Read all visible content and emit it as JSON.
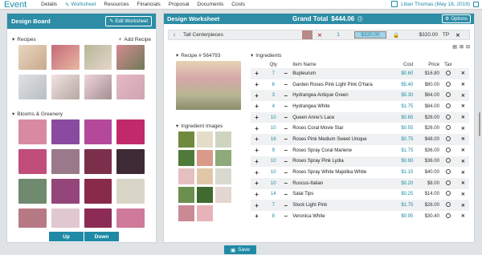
{
  "nav": {
    "brand": "Event",
    "items": [
      "Details",
      "Worksheet",
      "Resources",
      "Financials",
      "Proposal",
      "Documents",
      "Costs"
    ],
    "active_index": 1,
    "user": "Lilian Thomas (May 18, 2019)"
  },
  "left": {
    "title": "Design Board",
    "edit_label": "Edit Worksheet",
    "recipes_label": "Recipes",
    "add_recipe_label": "Add Recipe",
    "blooms_label": "Blooms & Greenery",
    "up_label": "Up",
    "down_label": "Down"
  },
  "right": {
    "title": "Design Worksheet",
    "grand_total_label": "Grand Total",
    "grand_total": "$444.06",
    "options_label": "Options",
    "item": {
      "name": "Tall Centerpieces",
      "qty": "1",
      "unit_price": "$320.00",
      "total": "$320.00",
      "code": "TP"
    },
    "recipe_label": "Recipe # 564793",
    "ingredient_images_label": "Ingredient Images",
    "ingredients_label": "Ingredients",
    "columns": {
      "qty": "Qty",
      "item": "Item Name",
      "cost": "Cost",
      "price": "Price",
      "tax": "Tax"
    },
    "rows": [
      {
        "qty": "7",
        "name": "Bupleurum",
        "cost": "$0.60",
        "price": "$16.80"
      },
      {
        "qty": "6",
        "name": "Garden Roses Pink Light Pink O'hara",
        "cost": "$5.40",
        "price": "$80.00"
      },
      {
        "qty": "3",
        "name": "Hydrangea Antique Green",
        "cost": "$5.30",
        "price": "$64.00"
      },
      {
        "qty": "4",
        "name": "Hydrangea White",
        "cost": "$1.75",
        "price": "$84.00"
      },
      {
        "qty": "10",
        "name": "Queen Anne's Lace",
        "cost": "$0.65",
        "price": "$26.00"
      },
      {
        "qty": "10",
        "name": "Roses Coral Movie Star",
        "cost": "$0.55",
        "price": "$26.00"
      },
      {
        "qty": "16",
        "name": "Roses Pink Medium Sweet Unique",
        "cost": "$0.75",
        "price": "$48.00"
      },
      {
        "qty": "9",
        "name": "Roses Spray Coral Mariene",
        "cost": "$1.75",
        "price": "$36.00"
      },
      {
        "qty": "10",
        "name": "Roses Spray Pink Lydia",
        "cost": "$0.90",
        "price": "$36.00"
      },
      {
        "qty": "10",
        "name": "Roses Spray White Majolika White",
        "cost": "$1.15",
        "price": "$40.00"
      },
      {
        "qty": "10",
        "name": "Ruscus-Italian",
        "cost": "$0.20",
        "price": "$8.00"
      },
      {
        "qty": "14",
        "name": "Salal Tips",
        "cost": "$0.25",
        "price": "$14.00"
      },
      {
        "qty": "7",
        "name": "Stock Light Pink",
        "cost": "$1.75",
        "price": "$28.00"
      },
      {
        "qty": "8",
        "name": "Veronica White",
        "cost": "$0.95",
        "price": "$30.40"
      }
    ],
    "save_label": "Save"
  },
  "colors": {
    "accent": "#2d8da6",
    "link": "#1a8ca6"
  }
}
